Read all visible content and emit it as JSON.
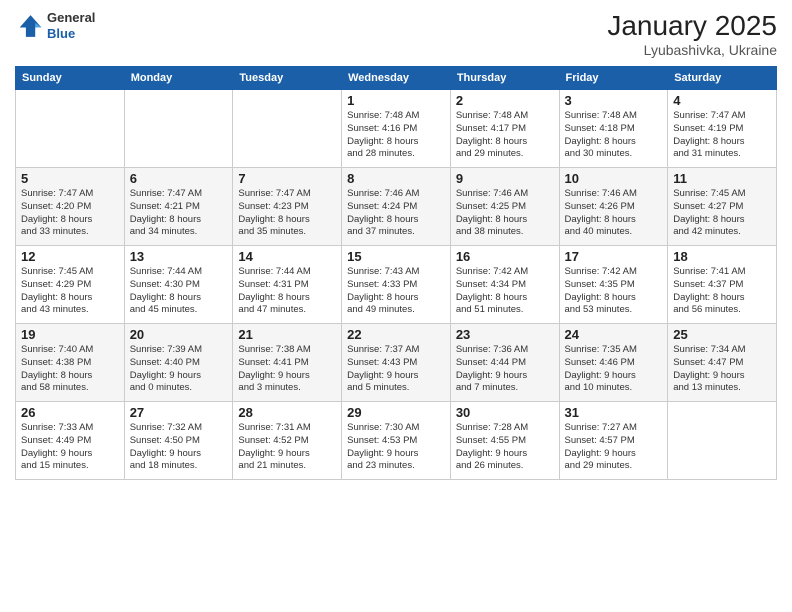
{
  "header": {
    "logo_general": "General",
    "logo_blue": "Blue",
    "month_title": "January 2025",
    "location": "Lyubashivka, Ukraine"
  },
  "days_of_week": [
    "Sunday",
    "Monday",
    "Tuesday",
    "Wednesday",
    "Thursday",
    "Friday",
    "Saturday"
  ],
  "weeks": [
    {
      "days": [
        {
          "num": "",
          "info": ""
        },
        {
          "num": "",
          "info": ""
        },
        {
          "num": "",
          "info": ""
        },
        {
          "num": "1",
          "info": "Sunrise: 7:48 AM\nSunset: 4:16 PM\nDaylight: 8 hours\nand 28 minutes."
        },
        {
          "num": "2",
          "info": "Sunrise: 7:48 AM\nSunset: 4:17 PM\nDaylight: 8 hours\nand 29 minutes."
        },
        {
          "num": "3",
          "info": "Sunrise: 7:48 AM\nSunset: 4:18 PM\nDaylight: 8 hours\nand 30 minutes."
        },
        {
          "num": "4",
          "info": "Sunrise: 7:47 AM\nSunset: 4:19 PM\nDaylight: 8 hours\nand 31 minutes."
        }
      ]
    },
    {
      "days": [
        {
          "num": "5",
          "info": "Sunrise: 7:47 AM\nSunset: 4:20 PM\nDaylight: 8 hours\nand 33 minutes."
        },
        {
          "num": "6",
          "info": "Sunrise: 7:47 AM\nSunset: 4:21 PM\nDaylight: 8 hours\nand 34 minutes."
        },
        {
          "num": "7",
          "info": "Sunrise: 7:47 AM\nSunset: 4:23 PM\nDaylight: 8 hours\nand 35 minutes."
        },
        {
          "num": "8",
          "info": "Sunrise: 7:46 AM\nSunset: 4:24 PM\nDaylight: 8 hours\nand 37 minutes."
        },
        {
          "num": "9",
          "info": "Sunrise: 7:46 AM\nSunset: 4:25 PM\nDaylight: 8 hours\nand 38 minutes."
        },
        {
          "num": "10",
          "info": "Sunrise: 7:46 AM\nSunset: 4:26 PM\nDaylight: 8 hours\nand 40 minutes."
        },
        {
          "num": "11",
          "info": "Sunrise: 7:45 AM\nSunset: 4:27 PM\nDaylight: 8 hours\nand 42 minutes."
        }
      ]
    },
    {
      "days": [
        {
          "num": "12",
          "info": "Sunrise: 7:45 AM\nSunset: 4:29 PM\nDaylight: 8 hours\nand 43 minutes."
        },
        {
          "num": "13",
          "info": "Sunrise: 7:44 AM\nSunset: 4:30 PM\nDaylight: 8 hours\nand 45 minutes."
        },
        {
          "num": "14",
          "info": "Sunrise: 7:44 AM\nSunset: 4:31 PM\nDaylight: 8 hours\nand 47 minutes."
        },
        {
          "num": "15",
          "info": "Sunrise: 7:43 AM\nSunset: 4:33 PM\nDaylight: 8 hours\nand 49 minutes."
        },
        {
          "num": "16",
          "info": "Sunrise: 7:42 AM\nSunset: 4:34 PM\nDaylight: 8 hours\nand 51 minutes."
        },
        {
          "num": "17",
          "info": "Sunrise: 7:42 AM\nSunset: 4:35 PM\nDaylight: 8 hours\nand 53 minutes."
        },
        {
          "num": "18",
          "info": "Sunrise: 7:41 AM\nSunset: 4:37 PM\nDaylight: 8 hours\nand 56 minutes."
        }
      ]
    },
    {
      "days": [
        {
          "num": "19",
          "info": "Sunrise: 7:40 AM\nSunset: 4:38 PM\nDaylight: 8 hours\nand 58 minutes."
        },
        {
          "num": "20",
          "info": "Sunrise: 7:39 AM\nSunset: 4:40 PM\nDaylight: 9 hours\nand 0 minutes."
        },
        {
          "num": "21",
          "info": "Sunrise: 7:38 AM\nSunset: 4:41 PM\nDaylight: 9 hours\nand 3 minutes."
        },
        {
          "num": "22",
          "info": "Sunrise: 7:37 AM\nSunset: 4:43 PM\nDaylight: 9 hours\nand 5 minutes."
        },
        {
          "num": "23",
          "info": "Sunrise: 7:36 AM\nSunset: 4:44 PM\nDaylight: 9 hours\nand 7 minutes."
        },
        {
          "num": "24",
          "info": "Sunrise: 7:35 AM\nSunset: 4:46 PM\nDaylight: 9 hours\nand 10 minutes."
        },
        {
          "num": "25",
          "info": "Sunrise: 7:34 AM\nSunset: 4:47 PM\nDaylight: 9 hours\nand 13 minutes."
        }
      ]
    },
    {
      "days": [
        {
          "num": "26",
          "info": "Sunrise: 7:33 AM\nSunset: 4:49 PM\nDaylight: 9 hours\nand 15 minutes."
        },
        {
          "num": "27",
          "info": "Sunrise: 7:32 AM\nSunset: 4:50 PM\nDaylight: 9 hours\nand 18 minutes."
        },
        {
          "num": "28",
          "info": "Sunrise: 7:31 AM\nSunset: 4:52 PM\nDaylight: 9 hours\nand 21 minutes."
        },
        {
          "num": "29",
          "info": "Sunrise: 7:30 AM\nSunset: 4:53 PM\nDaylight: 9 hours\nand 23 minutes."
        },
        {
          "num": "30",
          "info": "Sunrise: 7:28 AM\nSunset: 4:55 PM\nDaylight: 9 hours\nand 26 minutes."
        },
        {
          "num": "31",
          "info": "Sunrise: 7:27 AM\nSunset: 4:57 PM\nDaylight: 9 hours\nand 29 minutes."
        },
        {
          "num": "",
          "info": ""
        }
      ]
    }
  ]
}
